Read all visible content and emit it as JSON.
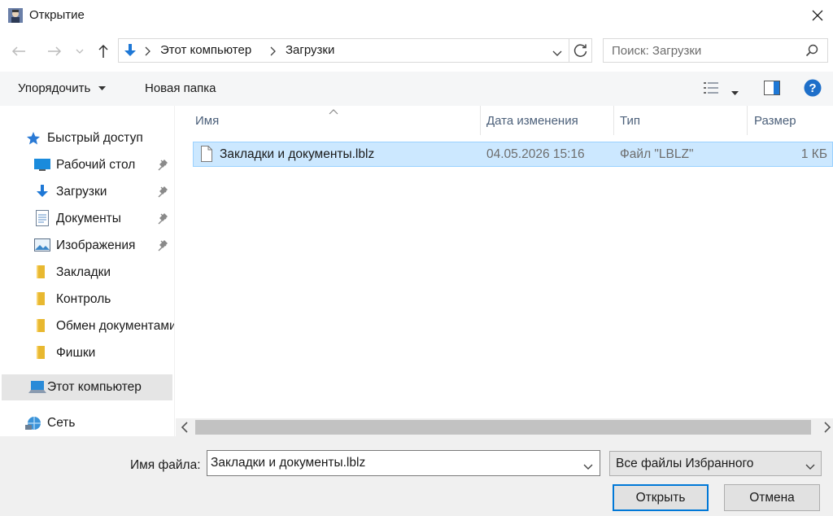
{
  "window": {
    "title": "Открытие"
  },
  "address": {
    "segments": [
      "Этот компьютер",
      "Загрузки"
    ],
    "search_placeholder": "Поиск: Загрузки"
  },
  "toolbar": {
    "organize_label": "Упорядочить",
    "new_folder_label": "Новая папка"
  },
  "nav": {
    "quick_access": "Быстрый доступ",
    "items": [
      {
        "label": "Рабочий стол",
        "icon": "desktop-icon",
        "pinned": true
      },
      {
        "label": "Загрузки",
        "icon": "download-arrow-icon",
        "pinned": true
      },
      {
        "label": "Документы",
        "icon": "document-icon",
        "pinned": true
      },
      {
        "label": "Изображения",
        "icon": "pictures-icon",
        "pinned": true
      },
      {
        "label": "Закладки",
        "icon": "folder-icon",
        "pinned": false
      },
      {
        "label": "Контроль",
        "icon": "folder-icon",
        "pinned": false
      },
      {
        "label": "Обмен документами",
        "icon": "folder-icon",
        "pinned": false
      },
      {
        "label": "Фишки",
        "icon": "folder-icon",
        "pinned": false
      }
    ],
    "this_pc": "Этот компьютер",
    "network": "Сеть"
  },
  "columns": {
    "name": "Имя",
    "date": "Дата изменения",
    "type": "Тип",
    "size": "Размер"
  },
  "files": [
    {
      "name": "Закладки и документы.lblz",
      "date": "04.05.2026 15:16",
      "type": "Файл \"LBLZ\"",
      "size": "1 КБ",
      "selected": true
    }
  ],
  "footer": {
    "filename_label": "Имя файла:",
    "filename_value": "Закладки и документы.lblz",
    "filetype_value": "Все файлы Избранного",
    "open_label": "Открыть",
    "cancel_label": "Отмена"
  },
  "colors": {
    "accent": "#0078d7",
    "selection": "#cce8ff",
    "help": "#1e6fc9"
  }
}
